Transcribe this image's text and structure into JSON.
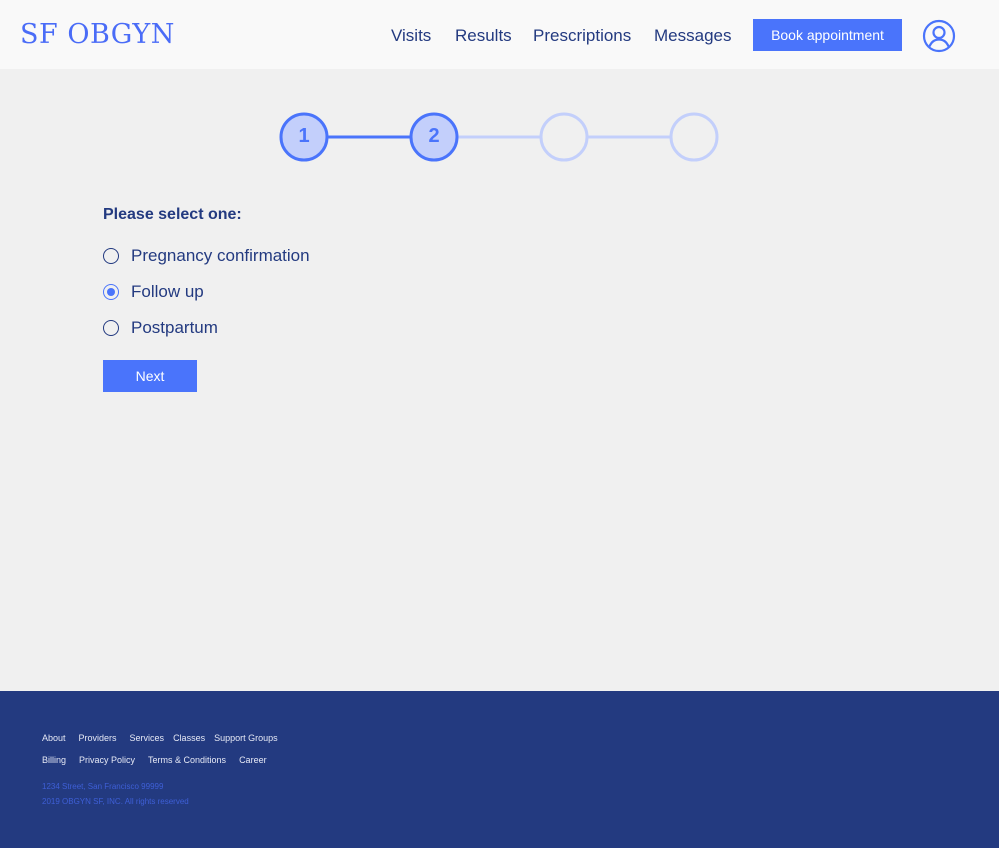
{
  "header": {
    "logo": "SF OBGYN",
    "nav": [
      "Visits",
      "Results",
      "Prescriptions",
      "Messages"
    ],
    "book_label": "Book appointment"
  },
  "stepper": {
    "steps": [
      "1",
      "2",
      "",
      ""
    ],
    "current_step": 2,
    "total_steps": 4
  },
  "form": {
    "question": "Please select one:",
    "options": [
      "Pregnancy confirmation",
      "Follow up",
      "Postpartum"
    ],
    "selected": "Follow up",
    "next_label": "Next"
  },
  "footer": {
    "links_row1": [
      "About",
      "Providers",
      "Services",
      "Classes",
      "Support Groups"
    ],
    "links_row2": [
      "Billing",
      "Privacy Policy",
      "Terms & Conditions",
      "Career"
    ],
    "address": "1234 Street, San Francisco 99999",
    "copyright": "2019 OBGYN SF, INC. All rights reserved"
  },
  "colors": {
    "accent": "#4a74fb",
    "navy": "#233a80",
    "step_inactive": "#c3cffb",
    "background": "#f0f0f0"
  }
}
